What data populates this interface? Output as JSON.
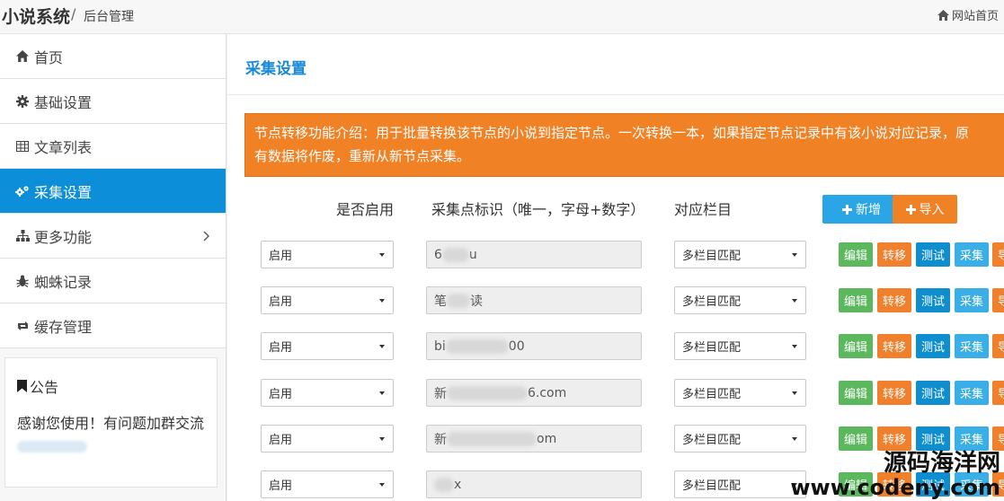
{
  "header": {
    "brand": "小说系统",
    "separator": "/",
    "subtitle": "后台管理",
    "home_link": "网站首页"
  },
  "sidebar": {
    "items": [
      {
        "label": "首页",
        "icon": "home-icon"
      },
      {
        "label": "基础设置",
        "icon": "gear-icon"
      },
      {
        "label": "文章列表",
        "icon": "table-icon"
      },
      {
        "label": "采集设置",
        "icon": "gears-icon",
        "active": true
      },
      {
        "label": "更多功能",
        "icon": "sitemap-icon"
      },
      {
        "label": "蜘蛛记录",
        "icon": "bug-icon"
      },
      {
        "label": "缓存管理",
        "icon": "refresh-icon"
      }
    ],
    "notice": {
      "title": "公告",
      "text": "感谢您使用！有问题加群交流"
    }
  },
  "main": {
    "title": "采集设置",
    "alert_line1": "节点转移功能介绍：用于批量转换该节点的小说到指定节点。一次转换一本，如果指定节点记录中有该小说对应记录，原",
    "alert_line2": "有数据将作废，重新从新节点采集。",
    "columns": {
      "enabled": "是否启用",
      "identifier": "采集点标识（唯一，字母+数字）",
      "category": "对应栏目"
    },
    "buttons": {
      "add": "新增",
      "import": "导入"
    },
    "actions": {
      "edit": "编辑",
      "move": "转移",
      "test": "测试",
      "collect": "采集",
      "more": "导"
    },
    "rows": [
      {
        "enabled": "启用",
        "id_prefix": "6",
        "id_suffix": "u",
        "category": "多栏目匹配"
      },
      {
        "enabled": "启用",
        "id_prefix": "笔",
        "id_suffix": "读",
        "category": "多栏目匹配"
      },
      {
        "enabled": "启用",
        "id_prefix": "bi",
        "id_suffix": "00",
        "category": "多栏目匹配"
      },
      {
        "enabled": "启用",
        "id_prefix": "新",
        "id_suffix": "6.com",
        "category": "多栏目匹配"
      },
      {
        "enabled": "启用",
        "id_prefix": "新",
        "id_suffix": "om",
        "category": "多栏目匹配"
      },
      {
        "enabled": "启用",
        "id_prefix": "",
        "id_suffix": "x",
        "category": "多栏目匹配"
      }
    ]
  },
  "watermark": {
    "line1": "源码海洋网",
    "line2": "www.codeny.com"
  },
  "colors": {
    "primary": "#0d8ed8",
    "orange": "#f08124",
    "green": "#5cb85c",
    "teal": "#0f8ecf",
    "sky": "#3aaee6"
  }
}
